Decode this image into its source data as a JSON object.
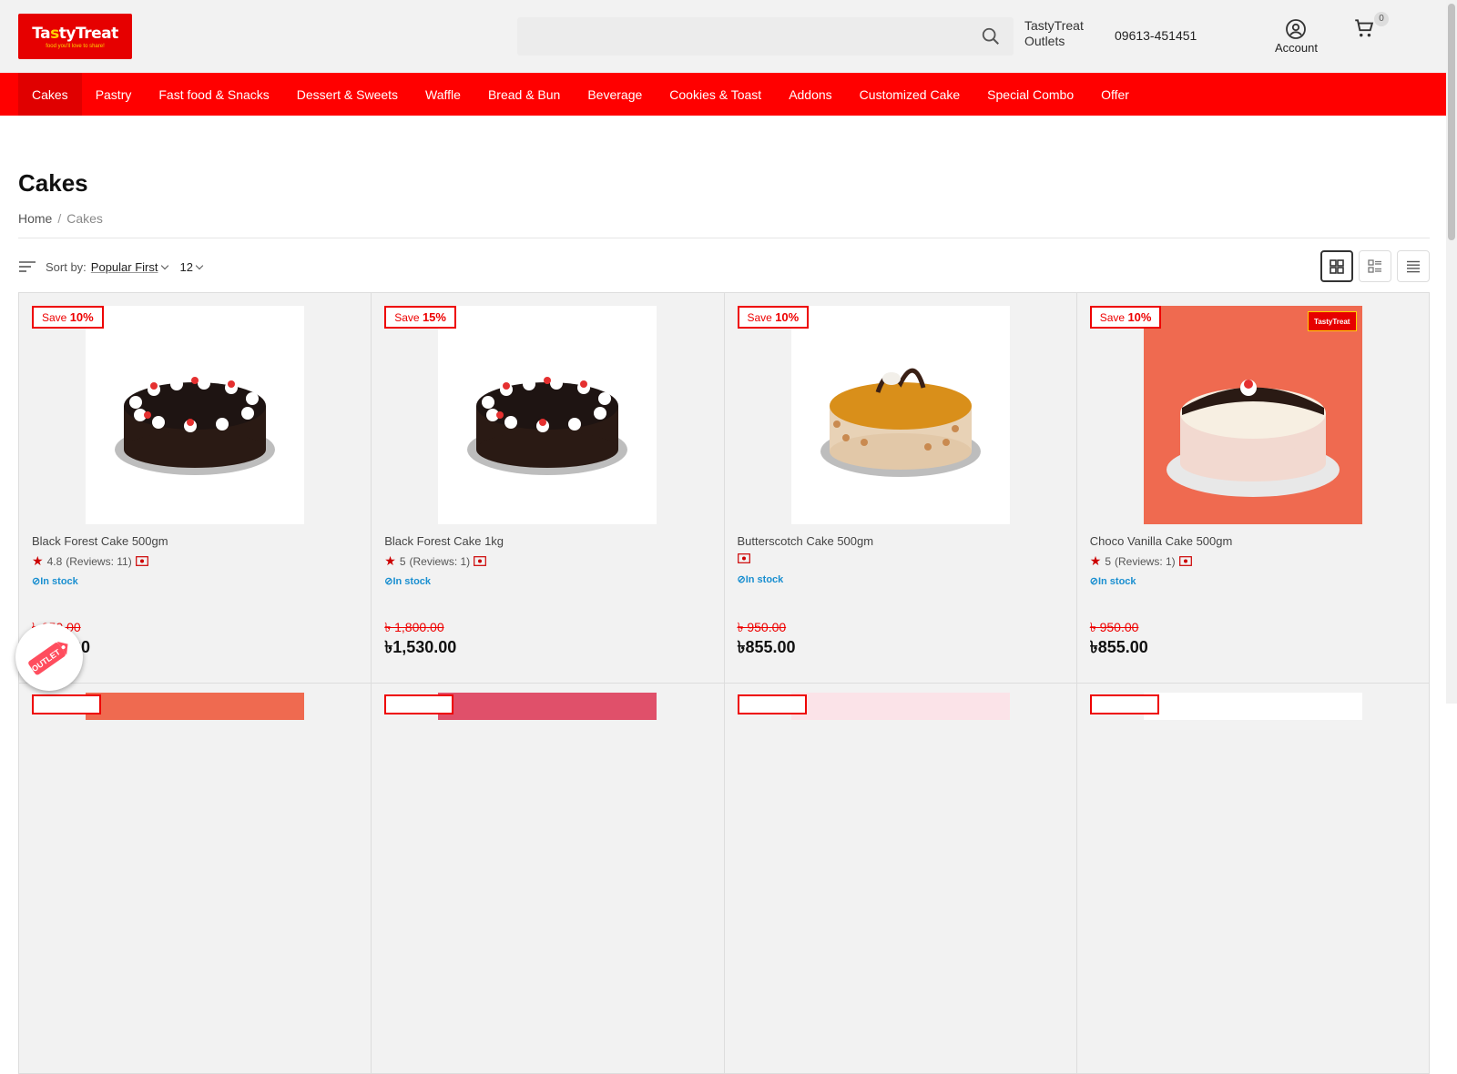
{
  "header": {
    "logo_text_a": "Ta",
    "logo_text_b": "s",
    "logo_text_c": "ty",
    "logo_text_d": "Treat",
    "logo_tagline": "food you'll love to share!",
    "search_placeholder": "",
    "outlets_line1": "TastyTreat",
    "outlets_line2": "Outlets",
    "phone": "09613-451451",
    "account_label": "Account",
    "cart_count": "0"
  },
  "nav": {
    "items": [
      "Cakes",
      "Pastry",
      "Fast food & Snacks",
      "Dessert & Sweets",
      "Waffle",
      "Bread & Bun",
      "Beverage",
      "Cookies & Toast",
      "Addons",
      "Customized Cake",
      "Special Combo",
      "Offer"
    ],
    "active": "Cakes"
  },
  "page": {
    "title": "Cakes",
    "breadcrumb": [
      "Home",
      "Cakes"
    ],
    "sort_label": "Sort by:",
    "sort_value": "Popular First",
    "per_page": "12"
  },
  "products": [
    {
      "save_prefix": "Save",
      "save_pct": "10%",
      "name": "Black Forest Cake 500gm",
      "rating": "4.8",
      "reviews": "(Reviews: 11)",
      "stock": "In stock",
      "old_price": "৳ 950.00",
      "price": "৳855.00"
    },
    {
      "save_prefix": "Save",
      "save_pct": "15%",
      "name": "Black Forest Cake 1kg",
      "rating": "5",
      "reviews": "(Reviews: 1)",
      "stock": "In stock",
      "old_price": "৳ 1,800.00",
      "price": "৳1,530.00"
    },
    {
      "save_prefix": "Save",
      "save_pct": "10%",
      "name": "Butterscotch Cake 500gm",
      "rating": "",
      "reviews": "",
      "stock": "In stock",
      "old_price": "৳ 950.00",
      "price": "৳855.00"
    },
    {
      "save_prefix": "Save",
      "save_pct": "10%",
      "name": "Choco Vanilla Cake 500gm",
      "rating": "5",
      "reviews": "(Reviews: 1)",
      "stock": "In stock",
      "old_price": "৳ 950.00",
      "price": "৳855.00"
    }
  ],
  "mini_logo_text": "TastyTreat",
  "outlet_badge_text": "OUTLET",
  "colors": {
    "brand_red": "#ff0000",
    "logo_yellow": "#ffd200",
    "stock_blue": "#1a8fd0"
  }
}
